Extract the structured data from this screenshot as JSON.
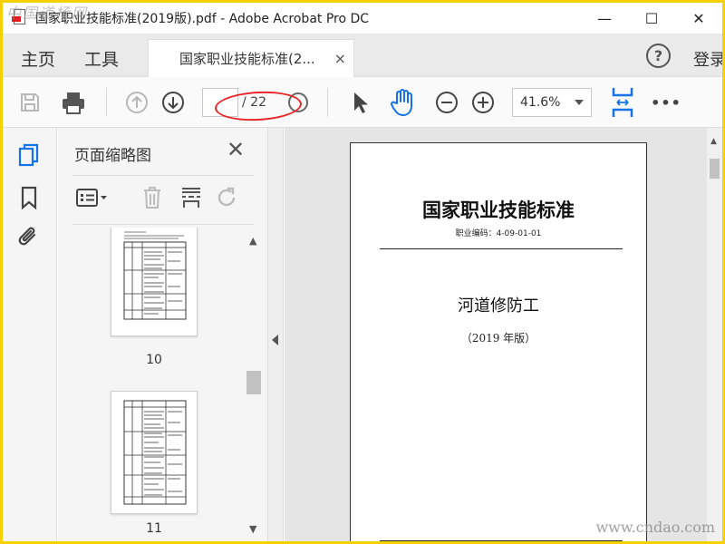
{
  "window": {
    "title": "国家职业技能标准(2019版).pdf - Adobe Acrobat Pro DC",
    "minimize_glyph": "—",
    "maximize_glyph": "☐",
    "close_glyph": "✕"
  },
  "watermark": {
    "top": "中国道杨网",
    "bottom": "www.cndao.com"
  },
  "tabs": {
    "home": "主页",
    "tools": "工具",
    "doc_tab": "国家职业技能标准(2...",
    "doc_tab_close": "×",
    "help": "?",
    "login": "登录"
  },
  "toolbar": {
    "page_current": "",
    "page_total": "/ 22",
    "zoom": "41.6%",
    "more": "•••",
    "icons": [
      "save-icon",
      "print-icon",
      "previous-page-icon",
      "next-page-icon",
      "select-cursor-icon",
      "hand-tool-icon",
      "zoom-out-icon",
      "zoom-in-icon",
      "fit-page-icon",
      "more-icon"
    ]
  },
  "sidebar": {
    "panel_title": "页面缩略图",
    "panel_close": "✕",
    "thumbnails": [
      {
        "label": "10"
      },
      {
        "label": "11"
      }
    ]
  },
  "document": {
    "title": "国家职业技能标准",
    "code": "职业编码：4-09-01-01",
    "subject": "河道修防工",
    "year": "（2019 年版）"
  },
  "colors": {
    "accent_blue": "#1473e6",
    "annotation_red": "#e8262a",
    "border_yellow": "#f7d000"
  }
}
